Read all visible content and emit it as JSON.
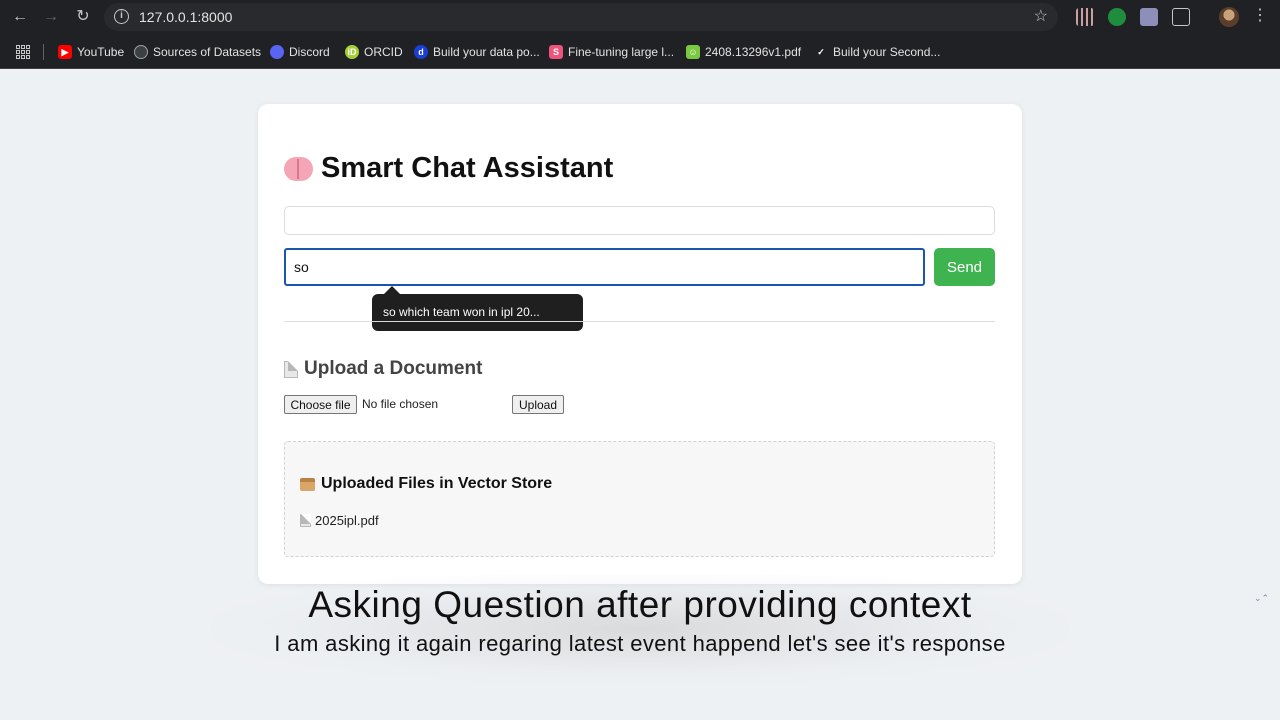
{
  "browser": {
    "url": "127.0.0.1:8000",
    "bookmarks": [
      {
        "label": "YouTube",
        "icon": "youtube-icon",
        "color": "#ff0000"
      },
      {
        "label": "Sources of Datasets",
        "icon": "globe-icon",
        "color": "#5f6368"
      },
      {
        "label": "Discord",
        "icon": "discord-icon",
        "color": "#5865f2"
      },
      {
        "label": "ORCID",
        "icon": "orcid-icon",
        "color": "#a6ce39"
      },
      {
        "label": "Build your data po...",
        "icon": "d-icon",
        "color": "#1a3fd6"
      },
      {
        "label": "Fine-tuning large l...",
        "icon": "s-icon",
        "color": "#f0537a"
      },
      {
        "label": "2408.13296v1.pdf",
        "icon": "pdf-icon",
        "color": "#7ac943"
      },
      {
        "label": "Build your Second...",
        "icon": "notion-icon",
        "color": "#ffffff"
      }
    ]
  },
  "app": {
    "title": "Smart Chat Assistant",
    "message_value": "so",
    "send_label": "Send",
    "autocomplete_suggestion": "so which team won in ipl 20...",
    "upload_heading": "Upload a Document",
    "choose_file_label": "Choose file",
    "no_file_text": "No file chosen",
    "upload_label": "Upload",
    "files_heading": "Uploaded Files in Vector Store",
    "files": [
      "2025ipl.pdf"
    ]
  },
  "caption": {
    "title": "Asking Question after providing context",
    "subtitle": "I am asking it again regaring latest event happend let's see it's response"
  },
  "colors": {
    "send_button": "#3fb34f",
    "input_focus_border": "#1a56b0"
  }
}
